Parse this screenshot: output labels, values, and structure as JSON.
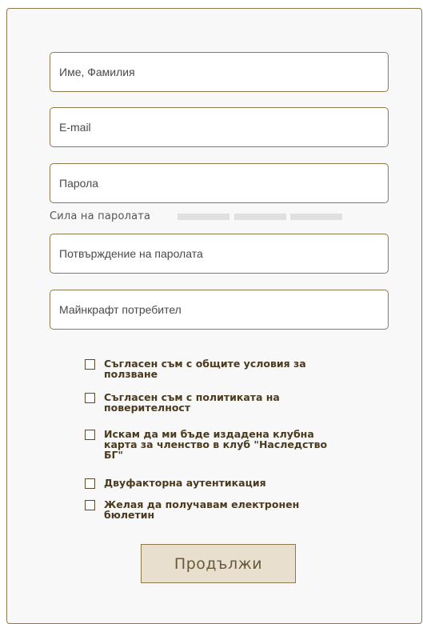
{
  "form": {
    "name_placeholder": "Име, Фамилия",
    "email_placeholder": "E-mail",
    "password_placeholder": "Парола",
    "strength_label": "Сила на паролата",
    "password_strength": 0,
    "confirm_placeholder": "Потвърждение на паролата",
    "minecraft_placeholder": "Майнкрафт потребител"
  },
  "checkboxes": [
    {
      "label": "Съгласен съм с общите условия за ползване",
      "checked": false
    },
    {
      "label": "Съгласен съм с политиката на поверителност",
      "checked": false
    },
    {
      "label": "Искам да ми бъде издадена клубна карта за членство в клуб \"Наследство БГ\"",
      "checked": false
    },
    {
      "label": "Двуфакторна аутентикация",
      "checked": false
    },
    {
      "label": "Желая да получавам електронен бюлетин",
      "checked": false
    }
  ],
  "submit_label": "Продължи",
  "colors": {
    "border": "#8a7a4e",
    "button_bg": "#e8dfcf",
    "text_brown": "#4a3a1e"
  }
}
